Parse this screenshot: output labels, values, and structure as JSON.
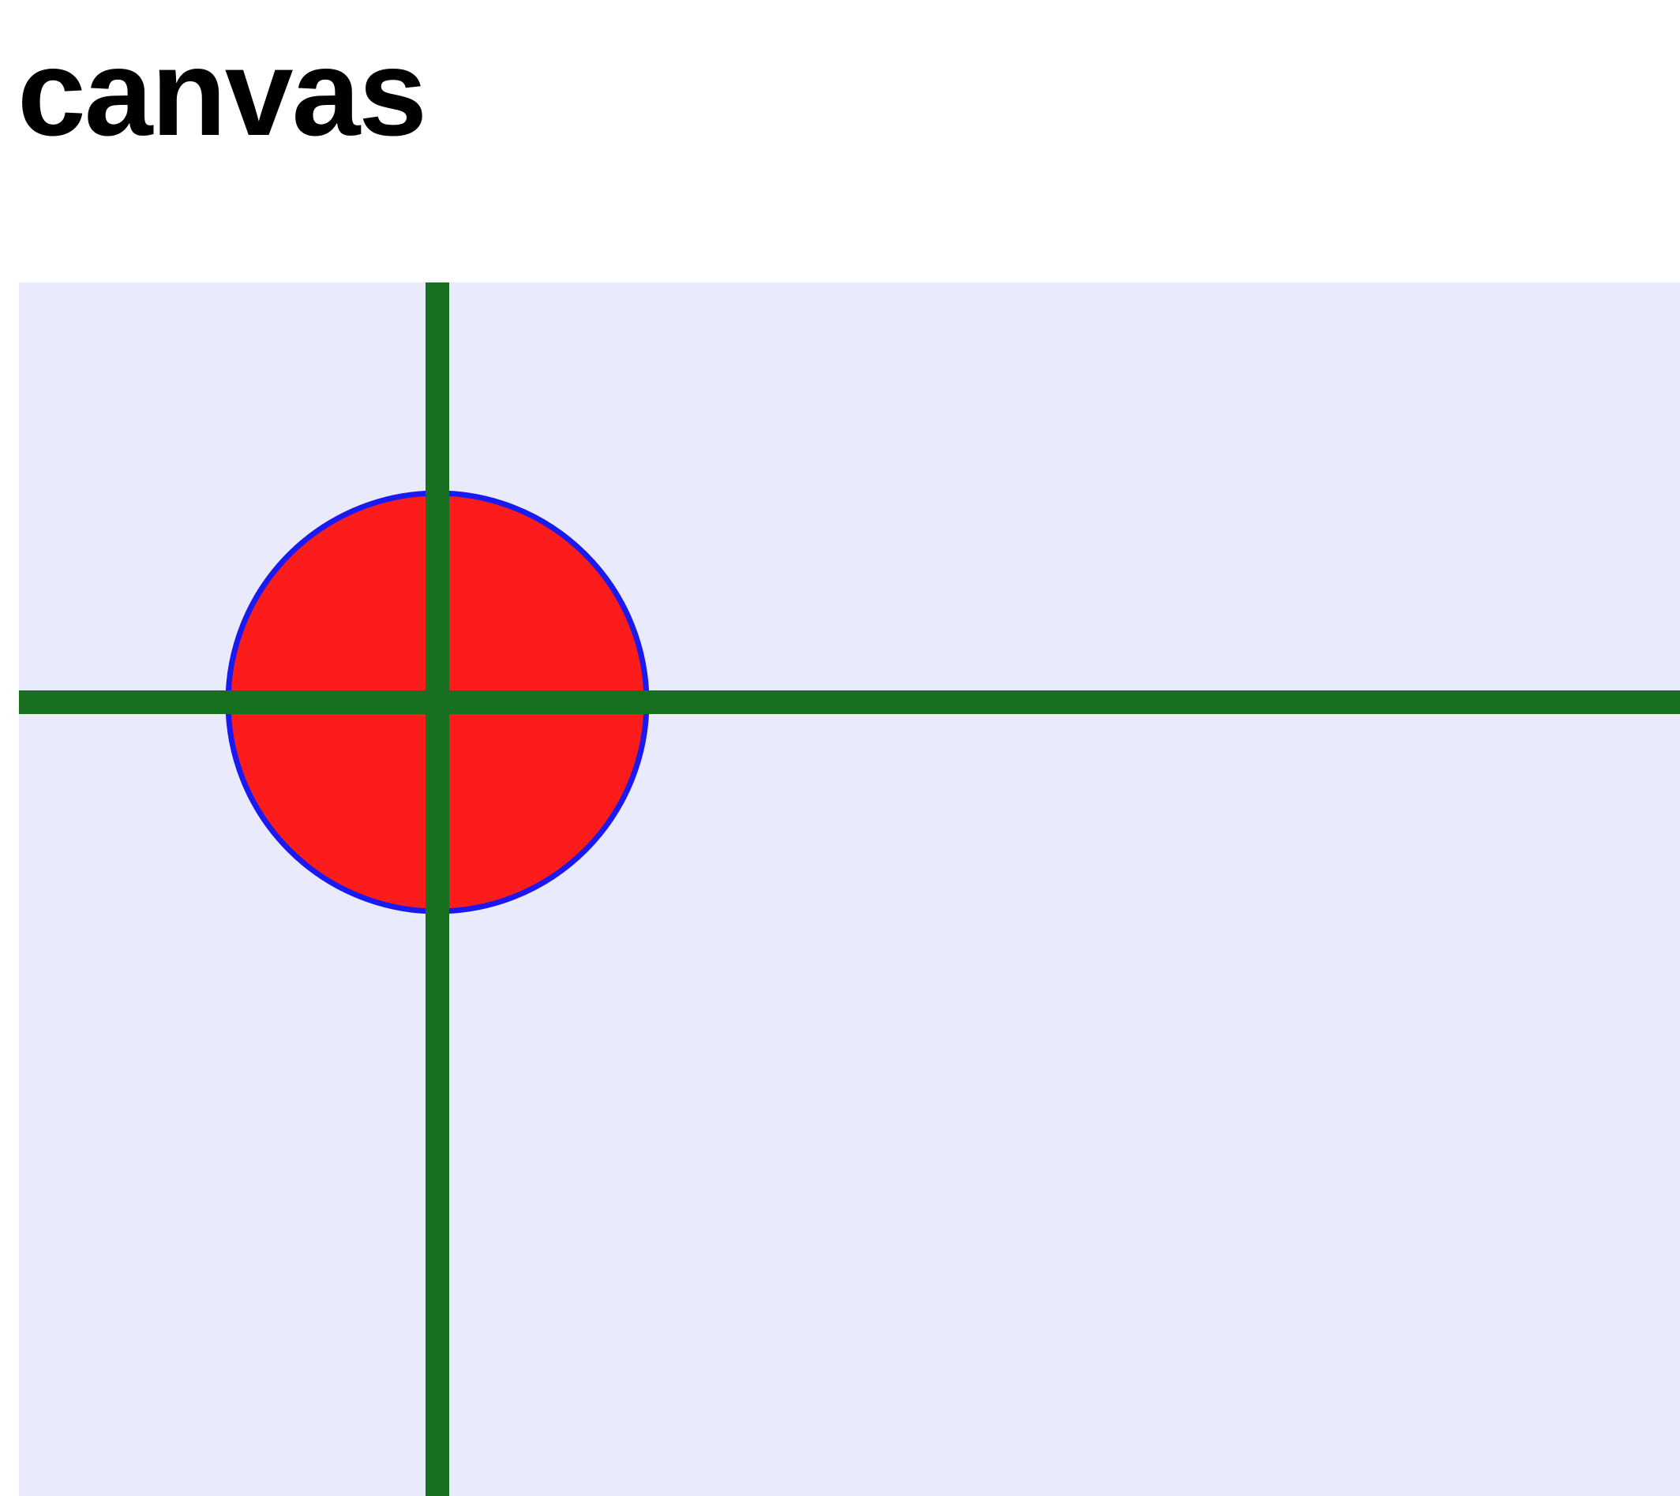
{
  "page": {
    "title": "canvas"
  },
  "canvas": {
    "background_color": "#e9eafb",
    "circle": {
      "fill_color": "#fc1c1c",
      "stroke_color": "#1a1af0"
    },
    "crosshair": {
      "line_color": "#167020"
    }
  }
}
